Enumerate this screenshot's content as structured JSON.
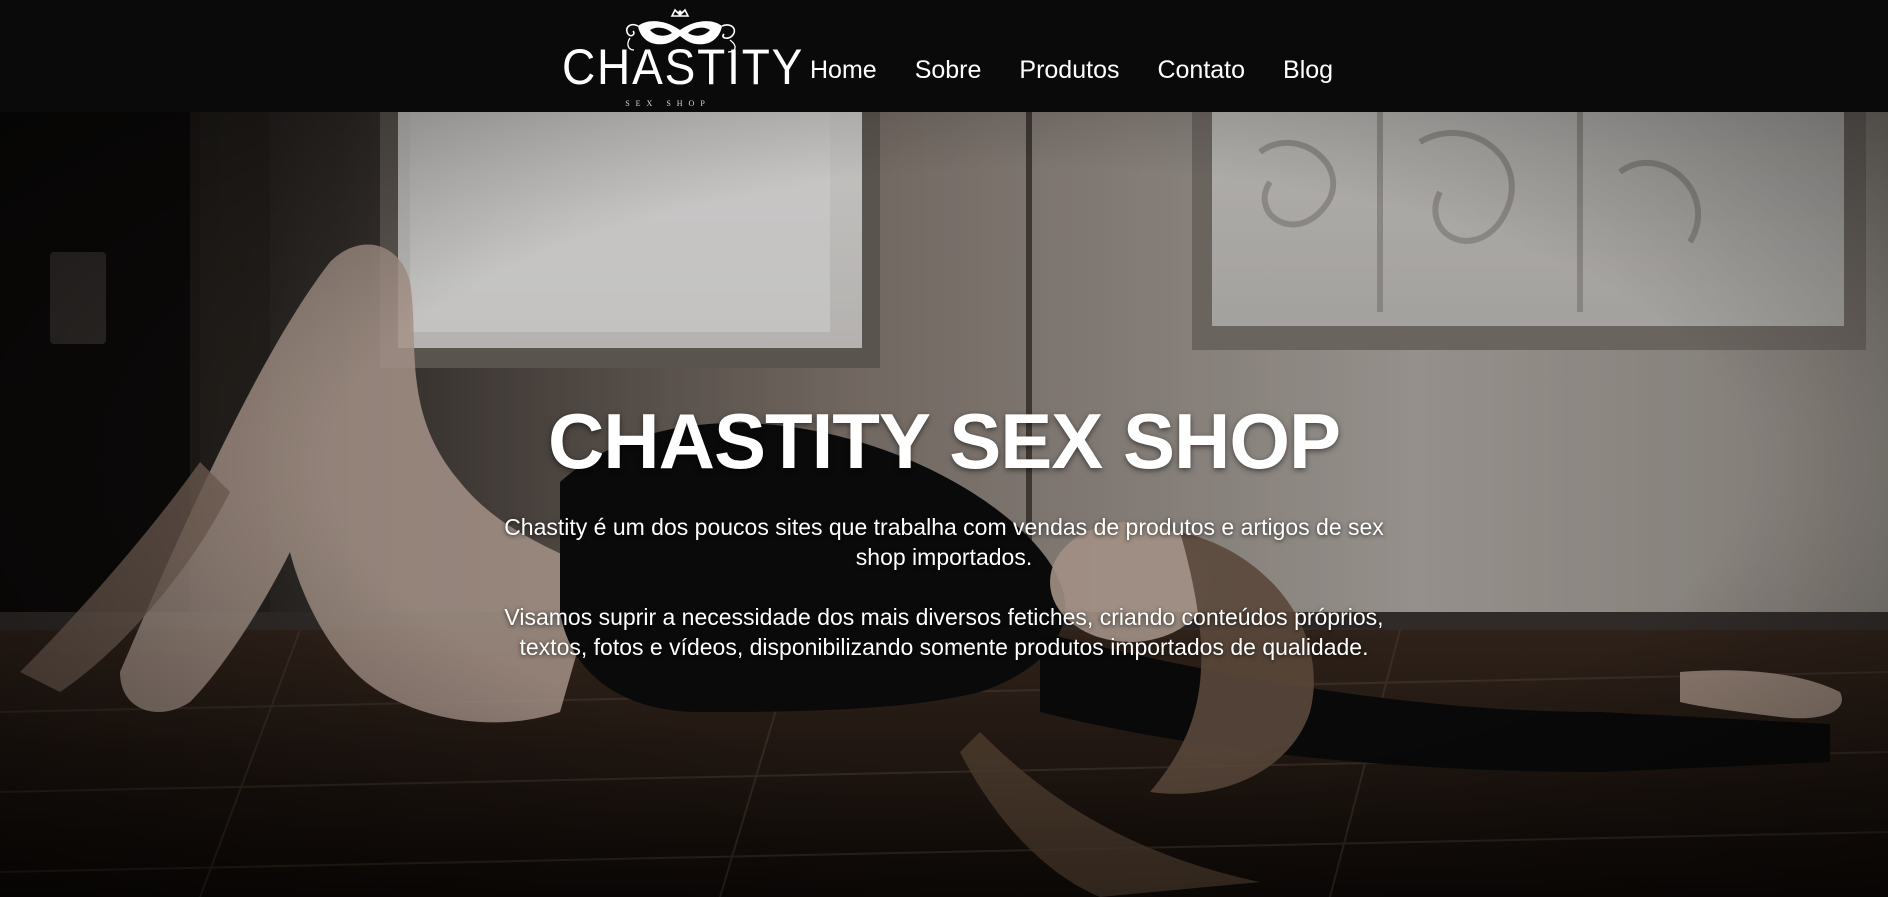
{
  "brand": {
    "logo_text": "CHASTITY",
    "logo_subtext": "SEX SHOP"
  },
  "nav": {
    "items": [
      {
        "label": "Home"
      },
      {
        "label": "Sobre"
      },
      {
        "label": "Produtos"
      },
      {
        "label": "Contato"
      },
      {
        "label": "Blog"
      }
    ]
  },
  "hero": {
    "title": "CHASTITY SEX SHOP",
    "paragraph_1": "Chastity é um dos poucos sites que trabalha com vendas de produtos e artigos de sex shop importados.",
    "paragraph_2": "Visamos suprir a necessidade dos mais diversos fetiches, criando conteúdos próprios, textos, fotos e vídeos, disponibilizando somente produtos importados de qualidade."
  },
  "colors": {
    "topbar": "#0a0a0a",
    "text": "#ffffff"
  },
  "icons": {
    "logo_mark": "masquerade-mask-icon"
  }
}
